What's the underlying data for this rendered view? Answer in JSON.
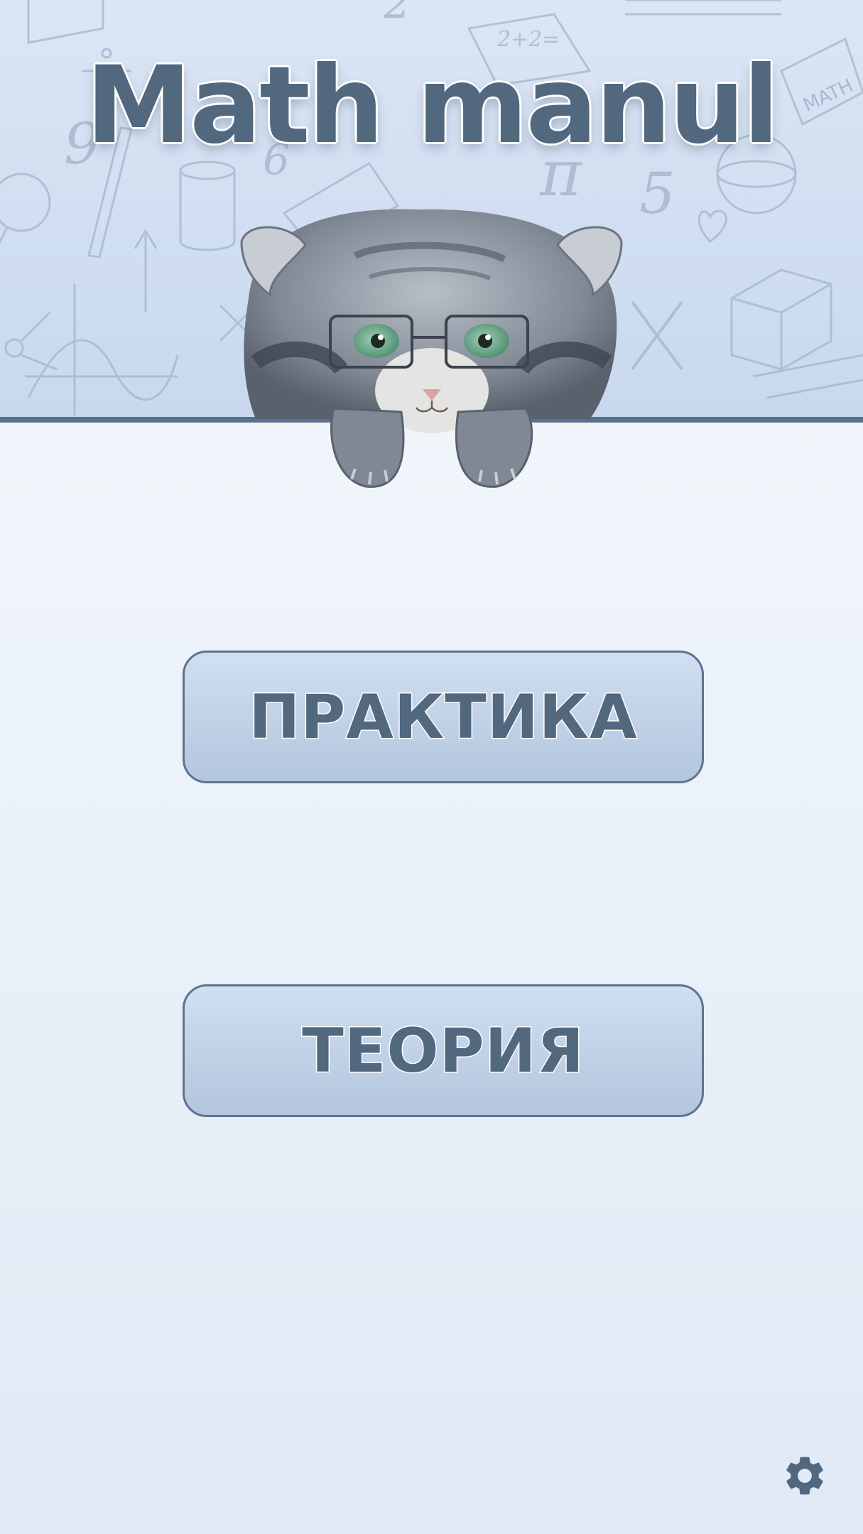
{
  "app": {
    "title": "Math manul"
  },
  "menu": {
    "practice_label": "ПРАКТИКА",
    "theory_label": "ТЕОРИЯ"
  },
  "background": {
    "doodle_texts": [
      "9",
      "6",
      "5",
      "2+2=",
      "π",
      "X",
      "2",
      "MATH"
    ]
  },
  "icons": {
    "settings": "gear-icon",
    "mascot": "manul-cat-with-glasses"
  },
  "colors": {
    "accent": "#52687f",
    "header_bg": "#c9d8ee",
    "header_line": "#58708f",
    "button_bg": "#c3d4ea"
  }
}
